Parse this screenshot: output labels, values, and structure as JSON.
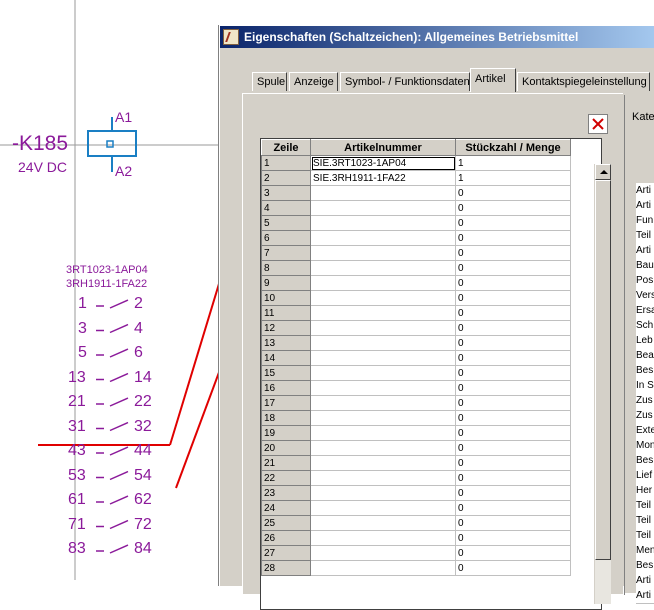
{
  "schematic": {
    "device_tag": "-K185",
    "voltage": "24V DC",
    "coil_terminal_top": "A1",
    "coil_terminal_bottom": "A2",
    "article_line1": "3RT1023-1AP04",
    "article_line2": "3RH1911-1FA22",
    "contacts": [
      {
        "a": "1",
        "b": "2"
      },
      {
        "a": "3",
        "b": "4"
      },
      {
        "a": "5",
        "b": "6"
      },
      {
        "a": "13",
        "b": "14"
      },
      {
        "a": "21",
        "b": "22"
      },
      {
        "a": "31",
        "b": "32"
      },
      {
        "a": "43",
        "b": "44"
      },
      {
        "a": "53",
        "b": "54"
      },
      {
        "a": "61",
        "b": "62"
      },
      {
        "a": "71",
        "b": "72"
      },
      {
        "a": "83",
        "b": "84"
      }
    ],
    "colors": {
      "symbol": "#8b1a9a",
      "coil": "#1a7fc4",
      "annotation": "#e00000"
    }
  },
  "dialog": {
    "title": "Eigenschaften (Schaltzeichen): Allgemeines Betriebsmittel",
    "tabs": [
      "Spule",
      "Anzeige",
      "Symbol- / Funktionsdaten",
      "Artikel",
      "Kontaktspiegeleinstellung"
    ],
    "active_tab": "Artikel",
    "close_icon": "red-x-icon",
    "table": {
      "headers": [
        "Zeile",
        "Artikelnummer",
        "Stückzahl / Menge"
      ],
      "rows": [
        [
          "1",
          "SIE.3RT1023-1AP04",
          "1"
        ],
        [
          "2",
          "SIE.3RH1911-1FA22",
          "1"
        ],
        [
          "3",
          "",
          "0"
        ],
        [
          "4",
          "",
          "0"
        ],
        [
          "5",
          "",
          "0"
        ],
        [
          "6",
          "",
          "0"
        ],
        [
          "7",
          "",
          "0"
        ],
        [
          "8",
          "",
          "0"
        ],
        [
          "9",
          "",
          "0"
        ],
        [
          "10",
          "",
          "0"
        ],
        [
          "11",
          "",
          "0"
        ],
        [
          "12",
          "",
          "0"
        ],
        [
          "13",
          "",
          "0"
        ],
        [
          "14",
          "",
          "0"
        ],
        [
          "15",
          "",
          "0"
        ],
        [
          "16",
          "",
          "0"
        ],
        [
          "17",
          "",
          "0"
        ],
        [
          "18",
          "",
          "0"
        ],
        [
          "19",
          "",
          "0"
        ],
        [
          "20",
          "",
          "0"
        ],
        [
          "21",
          "",
          "0"
        ],
        [
          "22",
          "",
          "0"
        ],
        [
          "23",
          "",
          "0"
        ],
        [
          "24",
          "",
          "0"
        ],
        [
          "25",
          "",
          "0"
        ],
        [
          "26",
          "",
          "0"
        ],
        [
          "27",
          "",
          "0"
        ],
        [
          "28",
          "",
          "0"
        ]
      ]
    },
    "right_panel": {
      "label": "Kate",
      "items": [
        "Arti",
        "Arti",
        "Fun",
        "Teil",
        "Arti",
        "Bau",
        "Pos",
        "Vers",
        "Ersa",
        "Sch",
        "Leb",
        "Bea",
        "Bes",
        "In S",
        "Zus",
        "Zus",
        "Exte",
        "Mon",
        "Bes",
        "Lief",
        "Her",
        "Teil",
        "Teil",
        "Teil",
        "Men",
        "Bes",
        "Arti",
        "Arti"
      ]
    }
  }
}
